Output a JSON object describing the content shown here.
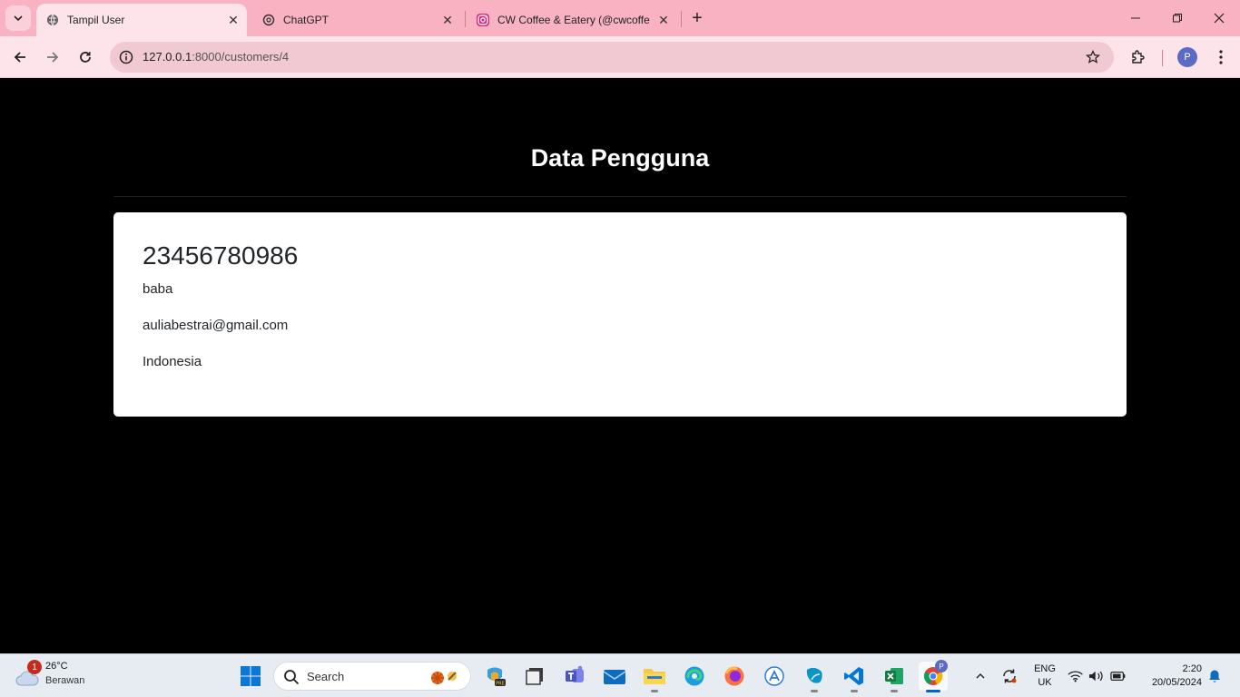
{
  "browser": {
    "tabs": [
      {
        "title": "Tampil User",
        "active": true
      },
      {
        "title": "ChatGPT",
        "active": false
      },
      {
        "title": "CW Coffee & Eatery (@cwcoffe",
        "active": false
      }
    ],
    "address": {
      "host": "127.0.0.1",
      "path": ":8000/customers/4"
    },
    "profile_initial": "P"
  },
  "page": {
    "title": "Data Pengguna",
    "customer": {
      "id": "23456780986",
      "name": "baba",
      "email": "auliabestrai@gmail.com",
      "country": "Indonesia"
    }
  },
  "taskbar": {
    "weather": {
      "temp": "26°C",
      "desc": "Berawan",
      "badge": "1"
    },
    "search_label": "Search",
    "lang": {
      "line1": "ENG",
      "line2": "UK"
    },
    "clock": {
      "time": "2:20",
      "date": "20/05/2024"
    },
    "chrome_badge": "P"
  },
  "colors": {
    "tabstrip": "#f8b2c2",
    "toolbar": "#fde4ea",
    "page_bg": "#000000",
    "card_bg": "#ffffff"
  }
}
